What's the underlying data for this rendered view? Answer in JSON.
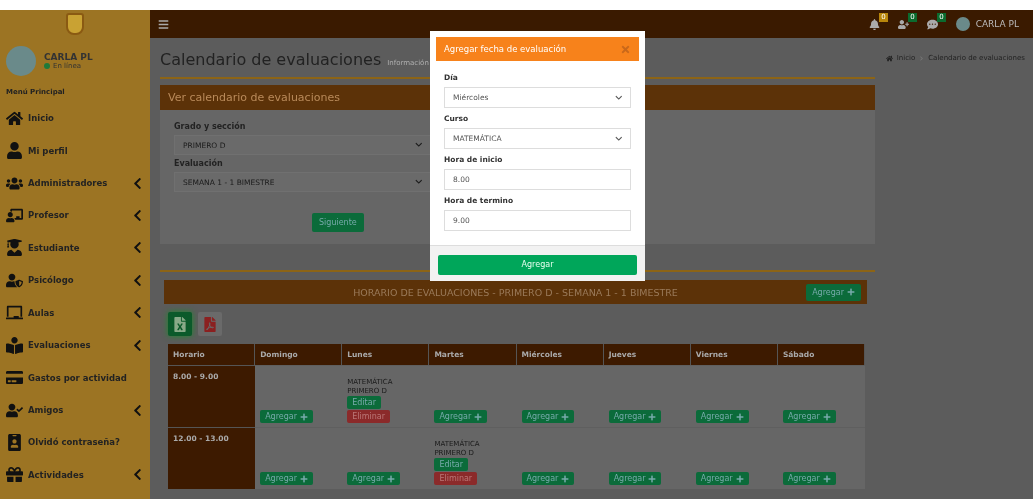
{
  "navbar": {
    "notifications": [
      {
        "count": "0",
        "color": "#b8860b"
      },
      {
        "count": "0",
        "color": "#0b6b2e"
      },
      {
        "count": "0",
        "color": "#0b6b2e"
      }
    ],
    "user": "CARLA PL"
  },
  "sidebar": {
    "user": {
      "name": "CARLA PL",
      "status": "En línea"
    },
    "section": "Menú Principal",
    "items": [
      {
        "label": "Inicio",
        "expandable": false
      },
      {
        "label": "Mi perfil",
        "expandable": false
      },
      {
        "label": "Administradores",
        "expandable": true
      },
      {
        "label": "Profesor",
        "expandable": true
      },
      {
        "label": "Estudiante",
        "expandable": true
      },
      {
        "label": "Psicólogo",
        "expandable": true
      },
      {
        "label": "Aulas",
        "expandable": true
      },
      {
        "label": "Evaluaciones",
        "expandable": true
      },
      {
        "label": "Gastos por actividad",
        "expandable": false
      },
      {
        "label": "Amigos",
        "expandable": true
      },
      {
        "label": "Olvidó contraseña?",
        "expandable": false
      },
      {
        "label": "Actividades",
        "expandable": true
      }
    ]
  },
  "page": {
    "title": "Calendario de evaluaciones",
    "subtitle": "Información",
    "breadcrumb": [
      "Inicio",
      "Calendario de evaluaciones"
    ]
  },
  "filter_panel": {
    "title": "Ver calendario de evaluaciones",
    "fields": [
      {
        "label": "Grado y sección",
        "value": "PRIMERO D"
      },
      {
        "label": "Evaluación",
        "value": "SEMANA 1 - 1 BIMESTRE"
      }
    ],
    "button": "Siguiente"
  },
  "schedule": {
    "title": "HORARIO DE EVALUACIONES - PRIMERO D - SEMANA 1 - 1 BIMESTRE",
    "add_button": "Agregar",
    "columns": [
      "Horario",
      "Domingo",
      "Lunes",
      "Martes",
      "Miércoles",
      "Jueves",
      "Viernes",
      "Sábado"
    ],
    "rows": [
      {
        "cells": [
          {
            "kind": "time",
            "text": "8.00 - 9.00"
          },
          {
            "kind": "add",
            "button": "Agregar"
          },
          {
            "kind": "event",
            "course": "MATEMÁTICA",
            "section": "PRIMERO D",
            "edit": "Editar",
            "delete": "Eliminar"
          },
          {
            "kind": "add",
            "button": "Agregar"
          },
          {
            "kind": "add",
            "button": "Agregar"
          },
          {
            "kind": "add",
            "button": "Agregar"
          },
          {
            "kind": "add",
            "button": "Agregar"
          },
          {
            "kind": "add",
            "button": "Agregar"
          }
        ]
      },
      {
        "cells": [
          {
            "kind": "time",
            "text": "12.00 - 13.00"
          },
          {
            "kind": "add",
            "button": "Agregar"
          },
          {
            "kind": "add",
            "button": "Agregar"
          },
          {
            "kind": "event",
            "course": "MATEMÁTICA",
            "section": "PRIMERO D",
            "edit": "Editar",
            "delete": "Eliminar"
          },
          {
            "kind": "add",
            "button": "Agregar"
          },
          {
            "kind": "add",
            "button": "Agregar"
          },
          {
            "kind": "add",
            "button": "Agregar"
          },
          {
            "kind": "add",
            "button": "Agregar"
          }
        ]
      }
    ]
  },
  "modal": {
    "title": "Agregar fecha de evaluación",
    "fields": [
      {
        "kind": "select",
        "label": "Día",
        "value": "Miércoles"
      },
      {
        "kind": "select",
        "label": "Curso",
        "value": "MATEMÁTICA"
      },
      {
        "kind": "input",
        "label": "Hora de inicio",
        "value": "8.00"
      },
      {
        "kind": "input",
        "label": "Hora de termino",
        "value": "9.00"
      }
    ],
    "button": "Agregar"
  }
}
